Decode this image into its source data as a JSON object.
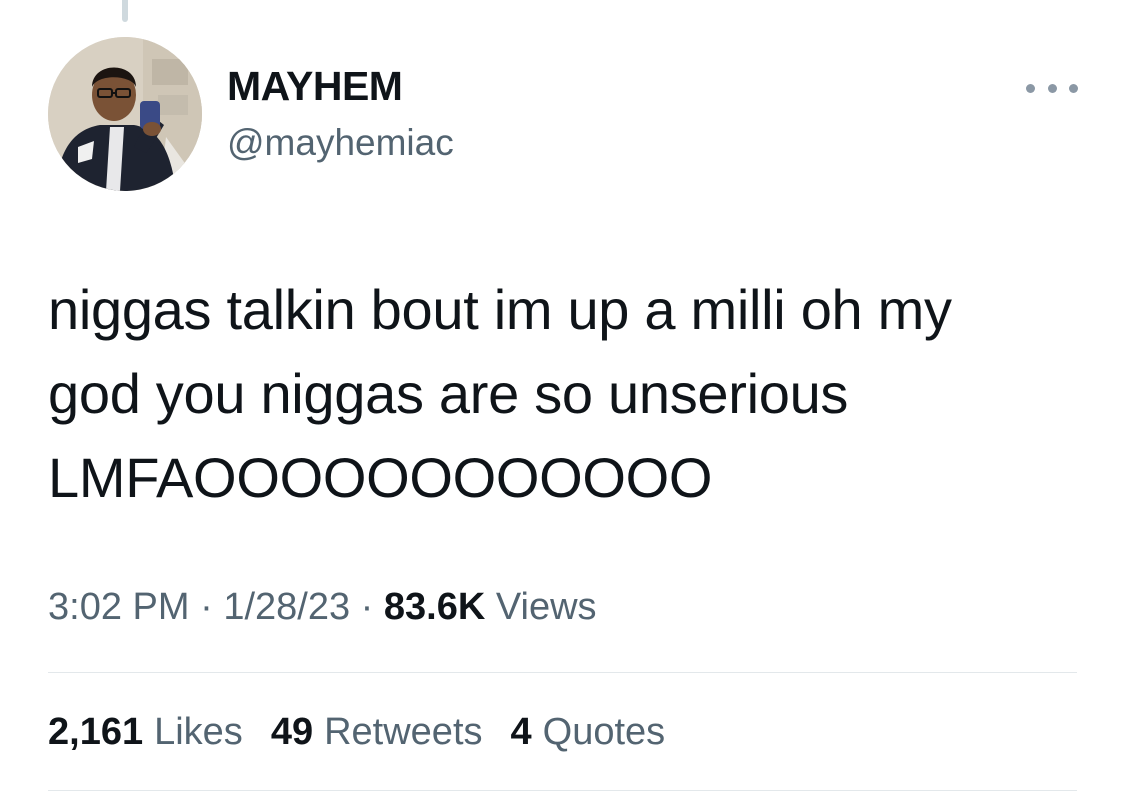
{
  "author": {
    "display_name": "MAYHEM",
    "handle": "@mayhemiac",
    "avatar_icon": "profile-photo"
  },
  "more_icon": "ellipsis-icon",
  "tweet": {
    "lines": [
      "niggas talkin bout im up a milli oh my",
      "god you niggas are so unserious",
      "LMFAOOOOOOOOOOOO"
    ]
  },
  "meta": {
    "time": "3:02 PM",
    "separator": "·",
    "date": "1/28/23",
    "views_count": "83.6K",
    "views_label": "Views"
  },
  "stats": {
    "likes_count": "2,161",
    "likes_label": "Likes",
    "retweets_count": "49",
    "retweets_label": "Retweets",
    "quotes_count": "4",
    "quotes_label": "Quotes"
  },
  "colors": {
    "text_primary": "#0f1419",
    "text_secondary": "#536471",
    "divider": "#e3e8eb",
    "background": "#ffffff"
  }
}
